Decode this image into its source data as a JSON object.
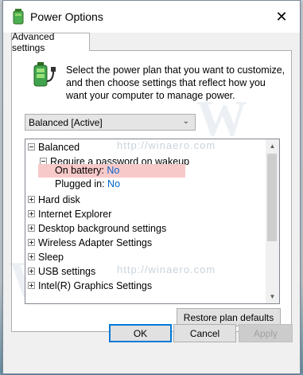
{
  "window": {
    "title": "Power Options",
    "close_label": "✕"
  },
  "tabs": [
    {
      "label": "Advanced settings"
    }
  ],
  "description": "Select the power plan that you want to customize, and then choose settings that reflect how you want your computer to manage power.",
  "plan_select": {
    "value": "Balanced [Active]"
  },
  "tree": {
    "plan": "Balanced",
    "group": "Require a password on wakeup",
    "settings": [
      {
        "label": "On battery:",
        "value": "No"
      },
      {
        "label": "Plugged in:",
        "value": "No"
      }
    ],
    "items": [
      "Hard disk",
      "Internet Explorer",
      "Desktop background settings",
      "Wireless Adapter Settings",
      "Sleep",
      "USB settings",
      "Intel(R) Graphics Settings"
    ]
  },
  "buttons": {
    "restore": "Restore plan defaults",
    "ok": "OK",
    "cancel": "Cancel",
    "apply": "Apply"
  },
  "watermark": "http://winaero.com",
  "colors": {
    "highlight": "#f8c9c9",
    "link": "#0066cc",
    "ok_border": "#0078d7"
  }
}
